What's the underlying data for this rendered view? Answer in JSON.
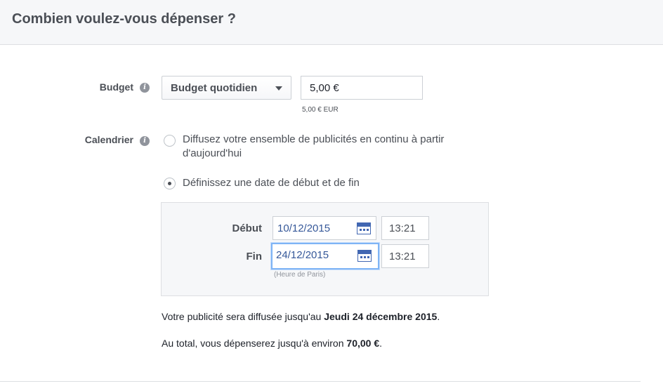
{
  "header": {
    "title": "Combien voulez-vous dépenser ?"
  },
  "budget": {
    "label": "Budget",
    "info_icon": "info-icon",
    "type_selected": "Budget quotidien",
    "amount_value": "5,00 €",
    "amount_note": "5,00 € EUR"
  },
  "schedule": {
    "label": "Calendrier",
    "info_icon": "info-icon",
    "options": [
      {
        "label_line1": "Diffusez votre ensemble de publicités en continu à partir",
        "label_line2": "d'aujourd'hui",
        "selected": false
      },
      {
        "label_line1": "Définissez une date de début et de fin",
        "selected": true
      }
    ],
    "start": {
      "label": "Début",
      "date": "10/12/2015",
      "time": "13:21"
    },
    "end": {
      "label": "Fin",
      "date": "24/12/2015",
      "time": "13:21"
    },
    "timezone_note": "(Heure de Paris)"
  },
  "summary": {
    "line1_prefix": "Votre publicité sera diffusée jusqu'au ",
    "line1_bold": "Jeudi 24 décembre 2015",
    "line1_suffix": ".",
    "line2_prefix": "Au total, vous dépenserez jusqu'à environ ",
    "line2_bold": "70,00 €",
    "line2_suffix": "."
  },
  "colors": {
    "header_bg": "#f6f7f9",
    "link_blue": "#365899",
    "focus_blue": "#7fb4f5",
    "text_gray": "#4b4f56"
  }
}
